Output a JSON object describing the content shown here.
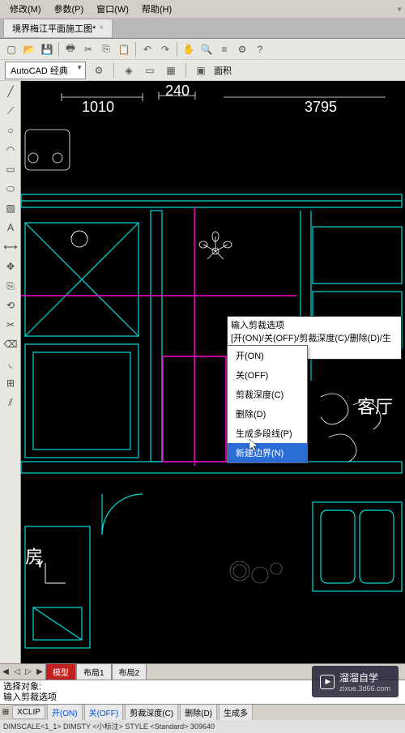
{
  "menubar": {
    "items": [
      "修改(M)",
      "参数(P)",
      "窗口(W)",
      "帮助(H)"
    ],
    "right_icon": "dropdown-icon"
  },
  "tab": {
    "title": "境界梅江平面施工图*",
    "close": "×"
  },
  "style": {
    "dropdown_label": "AutoCAD 经典",
    "area_label": "面积"
  },
  "toolbar_icons": [
    "new",
    "open",
    "save",
    "print",
    "cut",
    "copy",
    "paste",
    "match",
    "undo",
    "redo",
    "pan",
    "zoom",
    "layers",
    "properties"
  ],
  "side_icons": [
    "line",
    "polyline",
    "circle",
    "arc",
    "rect",
    "hatch",
    "text",
    "dim",
    "move",
    "copy",
    "rotate",
    "scale",
    "trim",
    "extend",
    "fillet",
    "array",
    "erase"
  ],
  "canvas": {
    "dims": {
      "d1": "1010",
      "d2": "240",
      "d3": "3795"
    },
    "room_labels": {
      "living": "客厅",
      "bedroom": "房"
    }
  },
  "context": {
    "title": "输入剪裁选项",
    "prompt": "[开(ON)/关(OFF)/剪裁深度(C)/删除(D)/生成",
    "items": [
      "开(ON)",
      "关(OFF)",
      "剪裁深度(C)",
      "删除(D)",
      "生成多段线(P)",
      "新建边界(N)"
    ]
  },
  "bottom_tabs": {
    "nav": [
      "◀",
      "◁",
      "▷",
      "▶"
    ],
    "tabs": [
      "模型",
      "布局1",
      "布局2"
    ]
  },
  "command": {
    "line1": "选择对象:",
    "line2": "输入剪裁选项"
  },
  "status": {
    "items": [
      "XCLIP",
      "开(ON)",
      "关(OFF)",
      "剪裁深度(C)",
      "删除(D)",
      "生成多"
    ]
  },
  "footer": {
    "text": "DIMSCALE<1_1> DIMSTY <小标注> STYLE <Standard>  309640"
  },
  "watermark": {
    "title": "溜溜自学",
    "sub": "zixue.3d66.com"
  }
}
